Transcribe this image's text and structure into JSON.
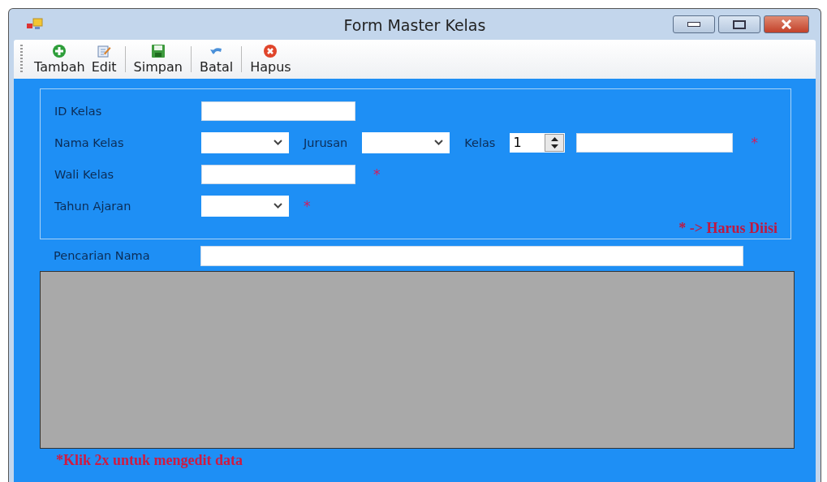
{
  "window": {
    "title": "Form Master Kelas"
  },
  "toolbar": [
    {
      "label": "Tambah",
      "kind": "add"
    },
    {
      "label": "Edit",
      "kind": "edit"
    },
    {
      "label": "Simpan",
      "kind": "save"
    },
    {
      "label": "Batal",
      "kind": "undo"
    },
    {
      "label": "Hapus",
      "kind": "delete"
    }
  ],
  "form": {
    "rows": [
      [
        {
          "kind": "label",
          "text": "ID Kelas"
        },
        {
          "kind": "text"
        }
      ],
      [
        {
          "kind": "label",
          "text": "Nama Kelas"
        },
        {
          "kind": "combo"
        },
        {
          "kind": "label",
          "text": "Jurusan"
        },
        {
          "kind": "combo"
        },
        {
          "kind": "label",
          "text": "Kelas"
        },
        {
          "kind": "spinner",
          "value": "1"
        },
        {
          "kind": "text"
        },
        {
          "kind": "required",
          "text": "*"
        }
      ],
      [
        {
          "kind": "label",
          "text": "Wali Kelas"
        },
        {
          "kind": "text"
        },
        {
          "kind": "required",
          "text": "*"
        }
      ],
      [
        {
          "kind": "label",
          "text": "Tahun Ajaran"
        },
        {
          "kind": "combo"
        },
        {
          "kind": "required",
          "text": "*"
        }
      ]
    ],
    "legend": "* -> Harus Diisi"
  },
  "search": {
    "label": "Pencarian Nama"
  },
  "footer_note": "*Klik 2x untuk mengedit data"
}
